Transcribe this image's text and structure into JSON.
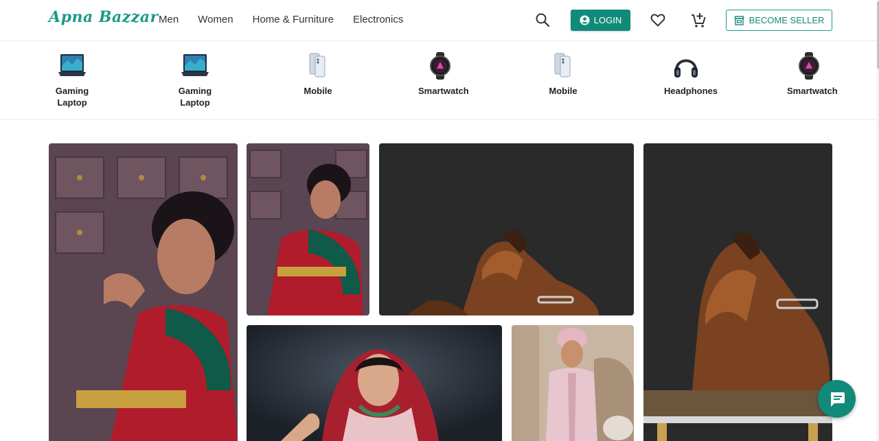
{
  "header": {
    "logo": "Apna Bazzar",
    "nav": [
      "Men",
      "Women",
      "Home & Furniture",
      "Electronics"
    ],
    "login_label": "LOGIN",
    "seller_label": "BECOME SELLER",
    "icons": {
      "search": "search-icon",
      "login": "account-icon",
      "wishlist": "heart-icon",
      "cart": "cart-add-icon",
      "seller": "store-icon"
    }
  },
  "categories": [
    {
      "label": "Gaming Laptop",
      "icon": "laptop"
    },
    {
      "label": "Gaming Laptop",
      "icon": "laptop"
    },
    {
      "label": "Mobile",
      "icon": "phone"
    },
    {
      "label": "Smartwatch",
      "icon": "watch"
    },
    {
      "label": "Mobile",
      "icon": "phone"
    },
    {
      "label": "Headphones",
      "icon": "headphones"
    },
    {
      "label": "Smartwatch",
      "icon": "watch"
    }
  ],
  "gallery": [
    "bride-red-saree",
    "bride-red-saree-small",
    "brown-loafers",
    "bride-red-dupatta",
    "groom-sherwani",
    "brown-loafers-tall"
  ],
  "colors": {
    "brand": "#118a7a",
    "logo": "#1a9a8a"
  },
  "chat": {
    "icon": "chat-icon"
  }
}
